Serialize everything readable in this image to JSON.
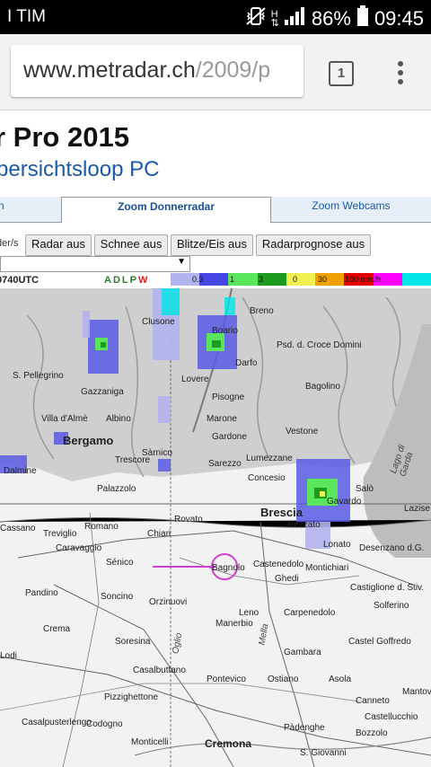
{
  "status_bar": {
    "carrier": "I TIM",
    "battery": "86%",
    "time": "09:45",
    "icons": [
      "vibrate-icon",
      "hspa-icon",
      "signal-icon",
      "battery-icon"
    ]
  },
  "browser": {
    "url_host": "www.metradar.ch",
    "url_path": "/2009/p",
    "tab_count": "1"
  },
  "page": {
    "title": "r Pro 2015",
    "subtitle": "bersichtsloop PC",
    "tabs": [
      {
        "label": "n"
      },
      {
        "label": "Zoom Donnerradar"
      },
      {
        "label": "Zoom Webcams"
      }
    ],
    "control_label": "der/s",
    "buttons": [
      "Radar aus",
      "Schnee aus",
      "Blitze/Eis aus",
      "Radarprognose aus"
    ],
    "time_label": "0740UTC",
    "adlpw": "ADLP",
    "adlpw_w": "W",
    "scale_labels": [
      "0.3",
      "1",
      "3",
      "0",
      "30",
      "100 mm/h"
    ]
  },
  "colors": {
    "scale": [
      "#b3b3f0",
      "#4646e6",
      "#5ae65a",
      "#1e9b1e",
      "#f0f050",
      "#f0a000",
      "#e60000",
      "#ff00ff",
      "#00e6e6"
    ]
  },
  "map": {
    "places": [
      {
        "name": "Bergamo",
        "cls": "big"
      },
      {
        "name": "Brescia",
        "cls": "big"
      },
      {
        "name": "Cremona",
        "cls": "mid"
      },
      {
        "name": "Clusone"
      },
      {
        "name": "Boario"
      },
      {
        "name": "Darfo"
      },
      {
        "name": "Lovere"
      },
      {
        "name": "Pisogne"
      },
      {
        "name": "Breno"
      },
      {
        "name": "Psd. d. Croce Domini"
      },
      {
        "name": "Bagolino"
      },
      {
        "name": "Vestone"
      },
      {
        "name": "Lumezzane"
      },
      {
        "name": "Gardone"
      },
      {
        "name": "Marone"
      },
      {
        "name": "Sarezzo"
      },
      {
        "name": "Concesio"
      },
      {
        "name": "Rezzato"
      },
      {
        "name": "Salò"
      },
      {
        "name": "Gavardo"
      },
      {
        "name": "Lonato"
      },
      {
        "name": "Desenzano d.G."
      },
      {
        "name": "Lazise"
      },
      {
        "name": "Montichiari"
      },
      {
        "name": "Ghedi"
      },
      {
        "name": "Castiglione d. Stiv."
      },
      {
        "name": "Solferino"
      },
      {
        "name": "Manerbio"
      },
      {
        "name": "Bagnolo"
      },
      {
        "name": "Castenedolo"
      },
      {
        "name": "Chiari"
      },
      {
        "name": "Rovato"
      },
      {
        "name": "Palazzolo"
      },
      {
        "name": "Romano"
      },
      {
        "name": "Treviglio"
      },
      {
        "name": "Caravaggio"
      },
      {
        "name": "Cassano"
      },
      {
        "name": "Dalmine"
      },
      {
        "name": "Villa d'Almè"
      },
      {
        "name": "Albino"
      },
      {
        "name": "Gazzaniga"
      },
      {
        "name": "Sàrnico"
      },
      {
        "name": "Trescore"
      },
      {
        "name": "S. Pellegrino"
      },
      {
        "name": "Soncino"
      },
      {
        "name": "Orzinuovi"
      },
      {
        "name": "Crema"
      },
      {
        "name": "Pandino"
      },
      {
        "name": "Soresina"
      },
      {
        "name": "Casalbuttano"
      },
      {
        "name": "Pontevico"
      },
      {
        "name": "Gambara"
      },
      {
        "name": "Asola"
      },
      {
        "name": "Ostiano"
      },
      {
        "name": "Pizzighettone"
      },
      {
        "name": "Codogno"
      },
      {
        "name": "Casalpusterlengo"
      },
      {
        "name": "Lodi"
      },
      {
        "name": "Pàdenghe"
      },
      {
        "name": "Bozzolo"
      },
      {
        "name": "Mantova"
      },
      {
        "name": "Castel Goffredo"
      },
      {
        "name": "Canneto"
      },
      {
        "name": "Castellucchio"
      },
      {
        "name": "S. Giovanni"
      },
      {
        "name": "Monticelli"
      },
      {
        "name": "Carpenedolo"
      },
      {
        "name": "Leno"
      },
      {
        "name": "Sénico"
      },
      {
        "name": "Lago di Garda"
      },
      {
        "name": "Mella"
      },
      {
        "name": "Oglio"
      }
    ]
  }
}
